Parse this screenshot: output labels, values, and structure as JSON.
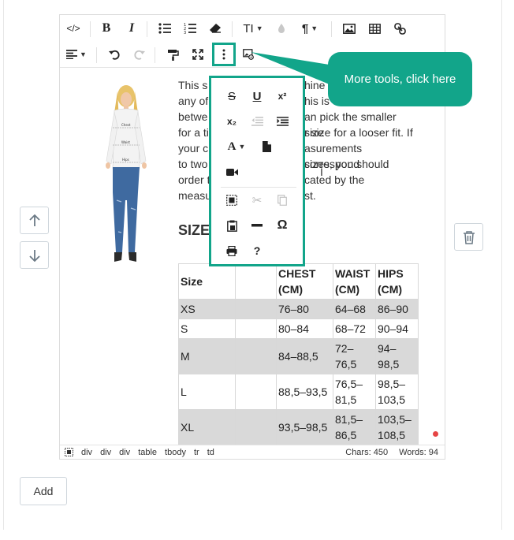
{
  "toolbar": {
    "row1": [
      {
        "name": "source-code-button",
        "icon": "code-icon",
        "glyph": "</>"
      },
      {
        "name": "bold-button",
        "icon": "bold-icon",
        "glyph": "B"
      },
      {
        "name": "italic-button",
        "icon": "italic-icon",
        "glyph": "I"
      },
      {
        "name": "bulleted-list-button",
        "icon": "bulleted-list-icon",
        "glyph": "ul"
      },
      {
        "name": "numbered-list-button",
        "icon": "numbered-list-icon",
        "glyph": "ol"
      },
      {
        "name": "eraser-button",
        "icon": "eraser-icon",
        "glyph": "eraser"
      },
      {
        "name": "font-size-button",
        "icon": "font-size-icon",
        "glyph": "TI"
      },
      {
        "name": "color-button",
        "icon": "droplet-icon",
        "glyph": "drop"
      },
      {
        "name": "paragraph-button",
        "icon": "pilcrow-icon",
        "glyph": "¶"
      },
      {
        "name": "image-button",
        "icon": "image-icon",
        "glyph": "img"
      },
      {
        "name": "table-button",
        "icon": "table-icon",
        "glyph": "tbl"
      },
      {
        "name": "link-button",
        "icon": "link-icon",
        "glyph": "link"
      }
    ],
    "row2": [
      {
        "name": "align-button",
        "icon": "align-left-icon"
      },
      {
        "name": "undo-button",
        "icon": "undo-icon"
      },
      {
        "name": "redo-button",
        "icon": "redo-icon"
      },
      {
        "name": "format-painter-button",
        "icon": "paint-roller-icon"
      },
      {
        "name": "fullscreen-button",
        "icon": "expand-icon"
      },
      {
        "name": "more-tools-button",
        "icon": "vertical-dots-icon"
      },
      {
        "name": "image-properties-button",
        "icon": "image-settings-icon"
      }
    ]
  },
  "content": {
    "paragraph_fragments": [
      "This s",
      "hine",
      "any of",
      "his is on",
      "betwe",
      "an pick the smaller size",
      "for a ti",
      "r size for a looser fit. If",
      "your c",
      "asurements correspond",
      "to two",
      "sizes, you should",
      "order t",
      "cated by the",
      "measu",
      "st."
    ],
    "heading": "SIZE",
    "table": {
      "headers": [
        "Size",
        "",
        "CHEST (CM)",
        "WAIST (CM)",
        "HIPS (CM)"
      ],
      "rows": [
        {
          "shade": true,
          "cells": [
            "XS",
            "",
            "76–80",
            "64–68",
            "86–90"
          ]
        },
        {
          "shade": false,
          "cells": [
            "S",
            "",
            "80–84",
            "68–72",
            "90–94"
          ]
        },
        {
          "shade": true,
          "cells": [
            "M",
            "",
            "84–88,5",
            "72–76,5",
            "94–98,5"
          ]
        },
        {
          "shade": false,
          "cells": [
            "L",
            "",
            "88,5–93,5",
            "76,5–81,5",
            "98,5–103,5"
          ]
        },
        {
          "shade": true,
          "cells": [
            "XL",
            "",
            "93,5–98,5",
            "81,5–86,5",
            "103,5–108,5"
          ]
        }
      ]
    },
    "model_labels": {
      "chest": "Chest",
      "waist": "Waist",
      "hips": "Hips"
    }
  },
  "popup": {
    "items": [
      {
        "name": "strikethrough-button",
        "icon": "strikethrough-icon",
        "label": "S",
        "dim": false
      },
      {
        "name": "underline-button",
        "icon": "underline-icon",
        "label": "U",
        "dim": false
      },
      {
        "name": "superscript-button",
        "icon": "superscript-icon",
        "label": "x²",
        "dim": false
      },
      {
        "name": "subscript-button",
        "icon": "subscript-icon",
        "label": "x₂",
        "dim": false
      },
      {
        "name": "outdent-button",
        "icon": "outdent-icon",
        "label": "",
        "dim": true
      },
      {
        "name": "indent-button",
        "icon": "indent-icon",
        "label": "",
        "dim": false
      },
      {
        "name": "font-family-button",
        "icon": "font-family-icon",
        "label": "A",
        "dim": false
      },
      {
        "name": "file-button",
        "icon": "file-icon",
        "label": "",
        "dim": false
      },
      {
        "name": "video-button",
        "icon": "video-icon",
        "label": "",
        "dim": false
      },
      {
        "name": "select-all-button",
        "icon": "select-all-icon",
        "label": "",
        "dim": false
      },
      {
        "name": "cut-button",
        "icon": "scissors-icon",
        "label": "✂",
        "dim": true
      },
      {
        "name": "copy-button",
        "icon": "copy-icon",
        "label": "",
        "dim": true
      },
      {
        "name": "paste-button",
        "icon": "paste-icon",
        "label": "",
        "dim": false
      },
      {
        "name": "horizontal-line-button",
        "icon": "horizontal-line-icon",
        "label": "",
        "dim": false
      },
      {
        "name": "special-character-button",
        "icon": "omega-icon",
        "label": "Ω",
        "dim": false
      },
      {
        "name": "print-button",
        "icon": "printer-icon",
        "label": "",
        "dim": false
      },
      {
        "name": "about-button",
        "icon": "question-icon",
        "label": "?",
        "dim": false
      }
    ]
  },
  "callout": {
    "text": "More tools, click here"
  },
  "statusbar": {
    "path": [
      "div",
      "div",
      "div",
      "table",
      "tbody",
      "tr",
      "td"
    ],
    "chars": "Chars: 450",
    "words": "Words: 94"
  },
  "buttons": {
    "add_label": "Add"
  },
  "colors": {
    "accent": "#12a58a",
    "shade": "#d9d9d9",
    "dot": "#e64545"
  }
}
